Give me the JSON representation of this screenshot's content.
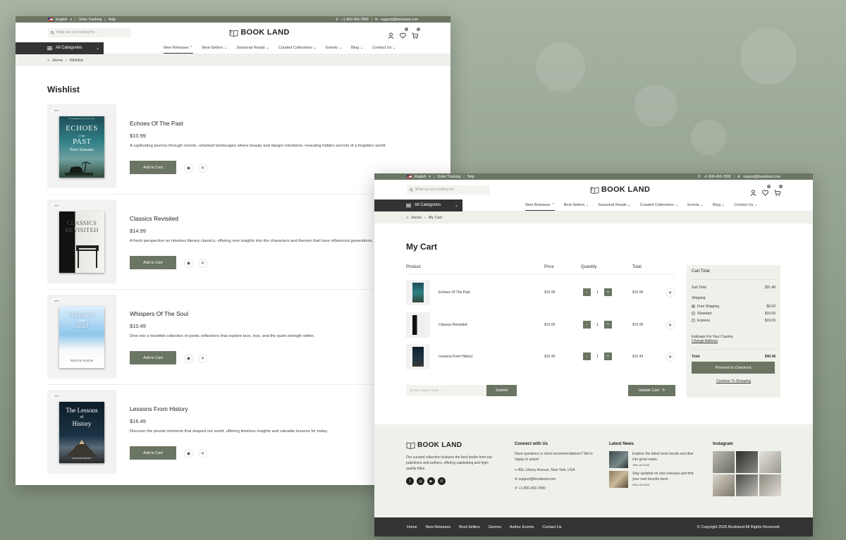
{
  "topbar": {
    "language": "English",
    "order_tracking": "Order Tracking",
    "help": "Help",
    "phone": "+1-800-456-7890",
    "email": "support@bookland.com"
  },
  "header": {
    "search_placeholder": "What are you looking for...",
    "logo": "BOOK LAND",
    "wishlist_count": "0",
    "cart_count": "0"
  },
  "nav": {
    "all_categories": "All Categories",
    "items": [
      "New Releases",
      "Best-Sellers",
      "Seasonal Reads",
      "Curated Collections",
      "Events",
      "Blog",
      "Contact Us"
    ]
  },
  "wishlist_page": {
    "breadcrumb_home": "Home",
    "breadcrumb_current": "Wishlist",
    "title": "Wishlist",
    "add_to_cart": "Add to Cart",
    "items": [
      {
        "discount": "-20%",
        "name": "Echoes Of The Past",
        "price": "$10.99",
        "desc": "A captivating journey through remote, untamed landscapes where beauty and danger intertwine, revealing hidden secrets of a forgotten world.",
        "cover_title": "ECHOES",
        "cover_sub": "PAST",
        "cover_author": "Peter Kimmer",
        "cover_top": "The Magnificent Cinema of the Past"
      },
      {
        "discount": "-20%",
        "name": "Classics Revisited",
        "price": "$14.99",
        "desc": "A fresh perspective on timeless literary classics, offering new insights into the characters and themes that have influenced generations.",
        "cover_title": "CLASSICS",
        "cover_sub": "REVISITED"
      },
      {
        "discount": "-40%",
        "name": "Whispers Of The Soul",
        "price": "$10.49",
        "desc": "Dive into a heartfelt collection of poetic reflections that explore love, loss, and the quiet strength within.",
        "cover_title": "Whispers",
        "cover_sub": "Soul",
        "cover_author": "NEENA SINGH"
      },
      {
        "discount": "-10%",
        "name": "Lessons From History",
        "price": "$16.49",
        "desc": "Discover the pivotal moments that shaped our world, offering timeless insights and valuable lessons for today.",
        "cover_title": "The Lessons",
        "cover_sub": "History",
        "cover_author": "SANKHADEEP"
      }
    ]
  },
  "cart_page": {
    "breadcrumb_home": "Home",
    "breadcrumb_current": "My Cart",
    "title": "My Cart",
    "columns": {
      "product": "Product",
      "price": "Price",
      "quantity": "Quantity",
      "total": "Total"
    },
    "rows": [
      {
        "name": "Echoes Of The Past",
        "price": "$10.99",
        "qty": "1",
        "total": "$10.99"
      },
      {
        "name": "Classics Revisited",
        "price": "$14.99",
        "qty": "1",
        "total": "$14.99"
      },
      {
        "name": "Lessons From History",
        "price": "$16.49",
        "qty": "1",
        "total": "$16.49"
      }
    ],
    "coupon_placeholder": "Enter coupon code...",
    "submit": "Submit",
    "update_cart": "Update Cart",
    "totals": {
      "heading": "Cart Total",
      "subtotal_label": "Sub Total",
      "subtotal": "$31.48",
      "shipping_label": "Shipping",
      "options": [
        {
          "label": "Free Shipping",
          "price": "$0.00",
          "selected": true
        },
        {
          "label": "Standard",
          "price": "$10.00",
          "selected": false
        },
        {
          "label": "Express",
          "price": "$19.00",
          "selected": false
        }
      ],
      "estimate_label": "Estimate For Your Country",
      "change_address": "Change Address",
      "total_label": "Total",
      "total": "$40.48",
      "checkout": "Proceed to Checkout",
      "continue": "Continue To Shopping"
    }
  },
  "footer": {
    "logo": "BOOK LAND",
    "about": "Our curated collection features the best books from top publishers and authors, offering captivating and high-quality titles.",
    "connect_heading": "Connect with Us",
    "connect_text": "Have questions or need recommendations? We're happy to assist!",
    "address": "456, Library Avenue, New York, USA",
    "email": "support@bookland.com",
    "phone": "+1 800-456-7890",
    "news_heading": "Latest News",
    "news": [
      {
        "text": "Explore the latest book trends and dive into great reads.",
        "date": "19th Jul 2025"
      },
      {
        "text": "Stay updated on new releases and find your next favorite book.",
        "date": "20th Jul 2025"
      }
    ],
    "instagram_heading": "Instagram",
    "bottom_links": [
      "Home",
      "New Releases",
      "Best-Sellers",
      "Genres",
      "Author Events",
      "Contact Us"
    ],
    "copyright": "© Copyright 2025 Bookland All Rights Reserved."
  },
  "colors": {
    "accent": "#6b7563",
    "dark": "#333333",
    "soft": "#eef1ea"
  }
}
